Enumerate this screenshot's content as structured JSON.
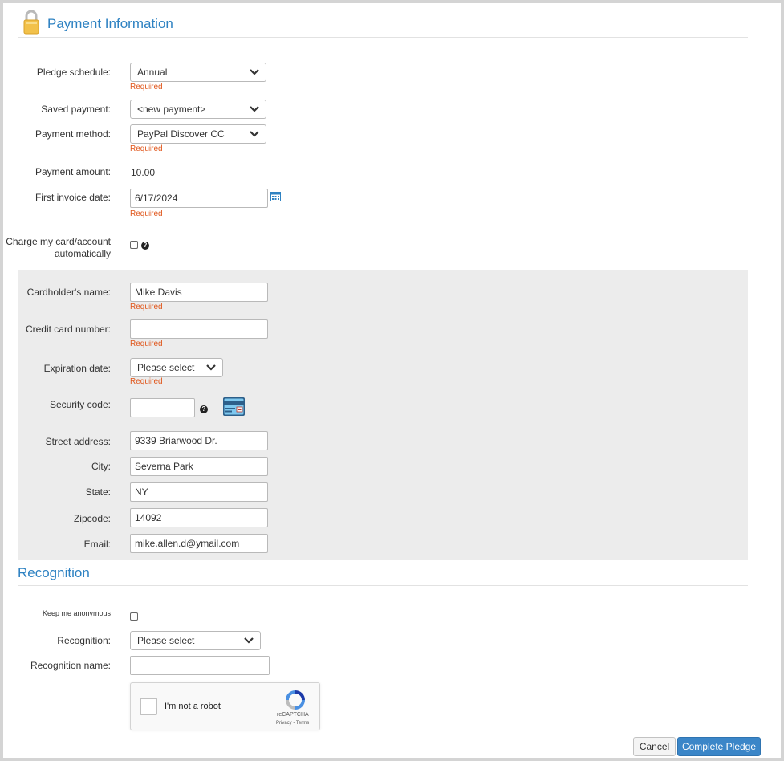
{
  "payment": {
    "title": "Payment Information",
    "required_text": "Required",
    "pledge_schedule": {
      "label": "Pledge schedule:",
      "value": "Annual"
    },
    "saved_payment": {
      "label": "Saved payment:",
      "value": "<new payment>"
    },
    "payment_method": {
      "label": "Payment method:",
      "value": "PayPal Discover CC"
    },
    "payment_amount": {
      "label": "Payment amount:",
      "value": "10.00"
    },
    "first_invoice_date": {
      "label": "First invoice date:",
      "value": "6/17/2024"
    },
    "charge_auto": {
      "label": "Charge my card/account automatically",
      "checked": false
    }
  },
  "card": {
    "cardholder_name": {
      "label": "Cardholder's name:",
      "value": "Mike Davis"
    },
    "card_number": {
      "label": "Credit card number:",
      "value": ""
    },
    "expiration": {
      "label": "Expiration date:",
      "value": "Please select"
    },
    "security_code": {
      "label": "Security code:",
      "value": ""
    },
    "street": {
      "label": "Street address:",
      "value": "9339 Briarwood Dr."
    },
    "city": {
      "label": "City:",
      "value": "Severna Park"
    },
    "state": {
      "label": "State:",
      "value": "NY"
    },
    "zipcode": {
      "label": "Zipcode:",
      "value": "14092"
    },
    "email": {
      "label": "Email:",
      "value": "mike.allen.d@ymail.com"
    }
  },
  "recognition": {
    "title": "Recognition",
    "anonymous": {
      "label": "Keep me anonymous",
      "checked": false
    },
    "recognition": {
      "label": "Recognition:",
      "value": "Please select"
    },
    "recognition_name": {
      "label": "Recognition name:",
      "value": ""
    }
  },
  "captcha": {
    "text": "I'm not a robot",
    "brand": "reCAPTCHA",
    "terms": "Privacy - Terms"
  },
  "actions": {
    "cancel": "Cancel",
    "complete": "Complete Pledge"
  },
  "colors": {
    "accent": "#2e82c2",
    "required": "#e0561b",
    "primary_button": "#3b86c8",
    "panel": "#ececec"
  },
  "icons": [
    "lock-icon",
    "chevron-down-icon",
    "calendar-icon",
    "help-icon",
    "credit-card-icon",
    "recaptcha-icon"
  ]
}
